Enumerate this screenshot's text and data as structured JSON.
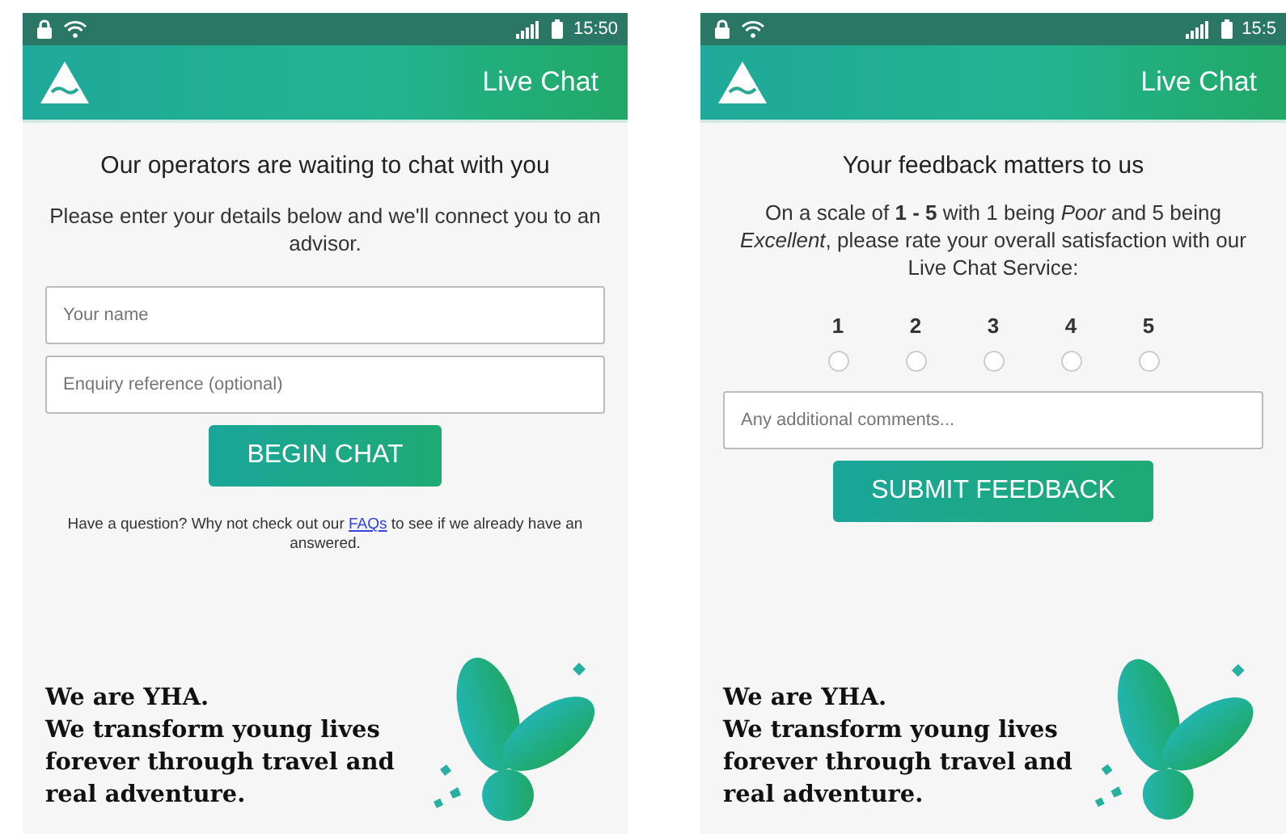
{
  "screens": [
    {
      "kind": "chat",
      "status_bar": {
        "time": "15:50"
      },
      "header": {
        "title": "Live Chat"
      },
      "heading": "Our operators are waiting to chat with you",
      "intro": "Please enter your details below and we'll connect you to an advisor.",
      "fields": [
        {
          "placeholder": "Your name"
        },
        {
          "placeholder": "Enquiry reference (optional)"
        }
      ],
      "button": "BEGIN CHAT",
      "faq": {
        "before": "Have a question? Why not check out our",
        "link": "FAQs",
        "after": "to see if we already have an answered."
      },
      "tagline": {
        "title": "We are YHA.",
        "body": "We transform young lives forever through travel and real adventure."
      }
    },
    {
      "kind": "feedback",
      "status_bar": {
        "time": "15:5"
      },
      "header": {
        "title": "Live Chat"
      },
      "heading": "Your feedback matters to us",
      "intro": "On a scale of **1 - 5** with 1 being *Poor* and 5 being *Excellent*, please rate your overall satisfaction with our Live Chat Service:",
      "ratings": [
        {
          "label": "1",
          "selected": false
        },
        {
          "label": "2",
          "selected": false
        },
        {
          "label": "3",
          "selected": false
        },
        {
          "label": "4",
          "selected": false
        },
        {
          "label": "5",
          "selected": false
        }
      ],
      "comments": {
        "placeholder": "Any additional comments..."
      },
      "button": "SUBMIT FEEDBACK",
      "tagline": {
        "title": "We are YHA.",
        "body": "We transform young lives forever through travel and real adventure."
      }
    }
  ]
}
